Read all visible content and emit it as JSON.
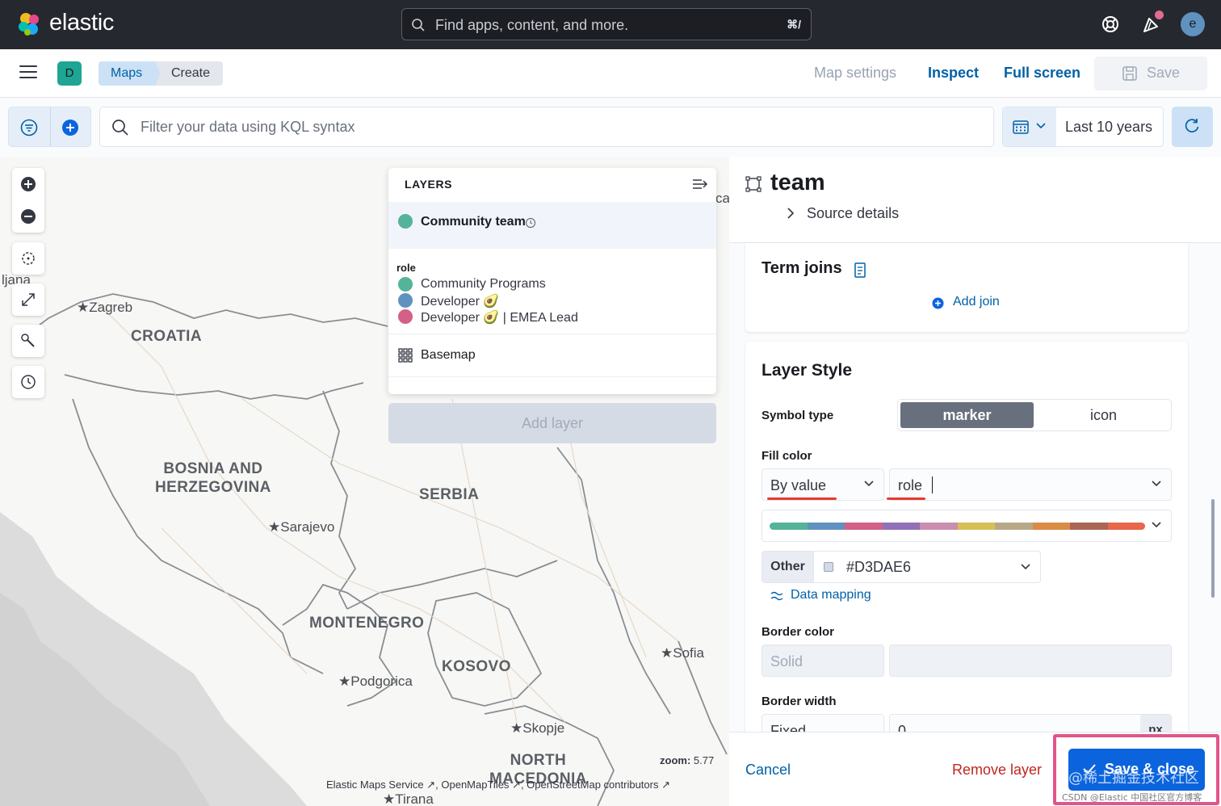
{
  "header": {
    "brand": "elastic",
    "search_placeholder": "Find apps, content, and more.",
    "search_shortcut": "⌘/",
    "avatar_initial": "e"
  },
  "toolbar": {
    "space_initial": "D",
    "breadcrumbs": [
      "Maps",
      "Create"
    ],
    "map_settings": "Map settings",
    "inspect": "Inspect",
    "full_screen": "Full screen",
    "save": "Save"
  },
  "query": {
    "kql_placeholder": "Filter your data using KQL syntax",
    "time_range": "Last 10 years"
  },
  "map": {
    "countries": [
      "CROATIA",
      "BOSNIA AND\nHERZEGOVINA",
      "SERBIA",
      "MONTENEGRO",
      "KOSOVO",
      "NORTH\nMACEDONIA"
    ],
    "cities": [
      "Zagreb",
      "Sarajevo",
      "Podgorica",
      "Sofia",
      "Skopje",
      "Tirana",
      "ljana"
    ],
    "partial_label": "ca",
    "zoom_label": "zoom:",
    "zoom_value": "5.77",
    "attribution": "Elastic Maps Service ↗, OpenMapTiles ↗, OpenStreetMap contributors ↗"
  },
  "layers": {
    "heading": "LAYERS",
    "items": [
      {
        "name": "Community team",
        "icon": "clock-icon"
      },
      {
        "name": "Basemap",
        "icon": "grid-icon"
      }
    ],
    "legend_title": "role",
    "legend": [
      {
        "label": "Community Programs",
        "color": "#54b399"
      },
      {
        "label": "Developer 🥑",
        "color": "#6092c0"
      },
      {
        "label": "Developer 🥑 | EMEA Lead",
        "color": "#d36086"
      }
    ],
    "add_layer": "Add layer"
  },
  "panel": {
    "title": "team",
    "source_details": "Source details",
    "term_joins": "Term joins",
    "add_join": "Add join",
    "layer_style": "Layer Style",
    "symbol_type_label": "Symbol type",
    "symbol_options": [
      "marker",
      "icon"
    ],
    "fill_color_label": "Fill color",
    "fill_mode": "By value",
    "fill_field": "role",
    "ramp_colors": [
      "#54b399",
      "#6092c0",
      "#d36086",
      "#9170b8",
      "#ca8eae",
      "#d6bf57",
      "#b9a888",
      "#da8b45",
      "#aa6556",
      "#e7664c"
    ],
    "other_label": "Other",
    "other_color": "#D3DAE6",
    "data_mapping": "Data mapping",
    "border_color_label": "Border color",
    "border_color_mode": "Solid",
    "border_width_label": "Border width",
    "border_width_mode": "Fixed",
    "border_width_value": "0",
    "border_width_unit": "px"
  },
  "footer": {
    "cancel": "Cancel",
    "remove_layer": "Remove layer",
    "save_close": "Save & close"
  },
  "watermark": "@稀土掘金技术社区",
  "watermark_small": "CSDN @Elastic 中国社区官方博客"
}
